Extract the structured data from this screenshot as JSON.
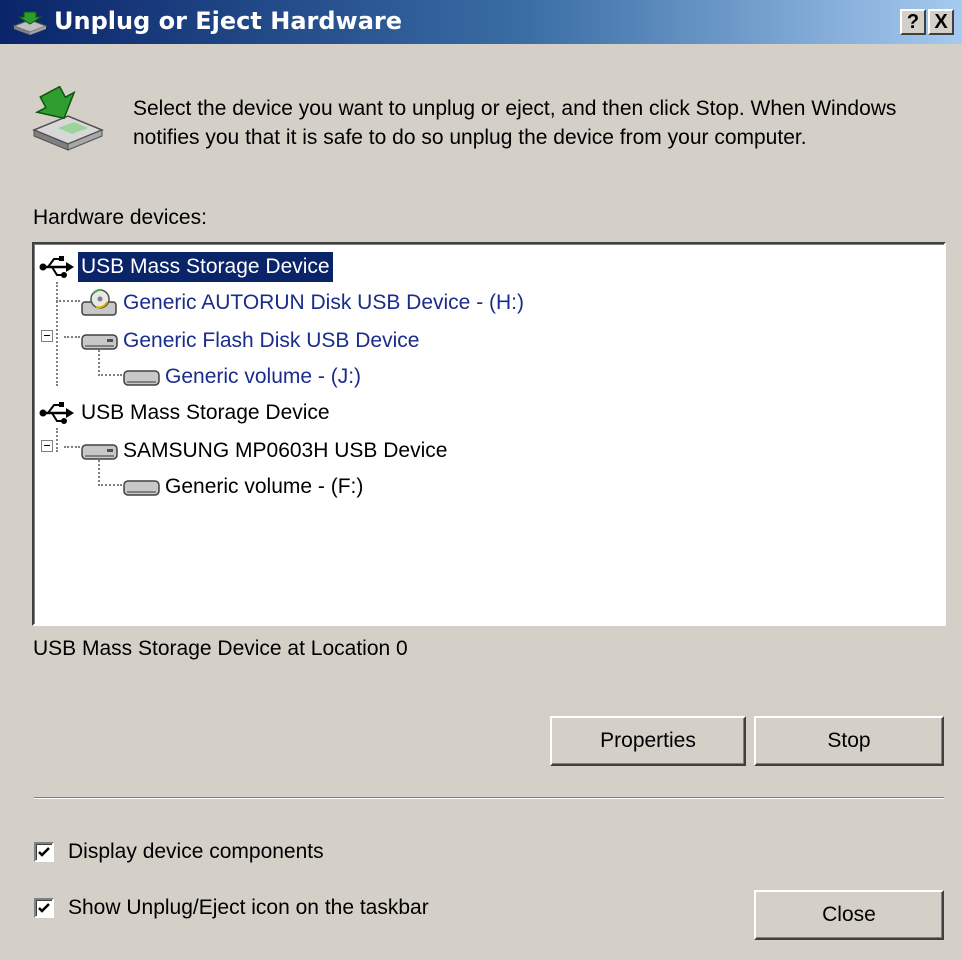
{
  "window": {
    "title": "Unplug or Eject Hardware",
    "help_label": "?",
    "close_label": "X"
  },
  "instructions": "Select the device you want to unplug or eject, and then click Stop. When Windows notifies you that it is safe to do so unplug the device from your computer.",
  "devices_label": "Hardware devices:",
  "tree": [
    {
      "label": "USB Mass Storage Device",
      "icon": "usb-icon",
      "level": 0,
      "selected": true
    },
    {
      "label": "Generic  AUTORUN  Disk USB Device - (H:)",
      "icon": "cd-drive-icon",
      "level": 1
    },
    {
      "label": "Generic Flash Disk USB Device",
      "icon": "disk-drive-icon",
      "level": 1,
      "expanded": true
    },
    {
      "label": "Generic volume - (J:)",
      "icon": "volume-icon",
      "level": 2
    },
    {
      "label": "USB Mass Storage Device",
      "icon": "usb-icon",
      "level": 0
    },
    {
      "label": "SAMSUNG MP0603H USB Device",
      "icon": "disk-drive-icon",
      "level": 1,
      "expanded": true
    },
    {
      "label": "Generic volume - (F:)",
      "icon": "volume-icon",
      "level": 2
    }
  ],
  "status_text": "USB Mass Storage Device at Location 0",
  "buttons": {
    "properties": "Properties",
    "stop": "Stop",
    "close": "Close"
  },
  "checkboxes": [
    {
      "label": "Display device components",
      "checked": true
    },
    {
      "label": "Show Unplug/Eject icon on the taskbar",
      "checked": true
    }
  ],
  "colors": {
    "title_start": "#0a246a",
    "title_end": "#a6caf0",
    "selection": "#0a246a",
    "face": "#d4d0c8",
    "link_text": "#1a2c8c"
  }
}
